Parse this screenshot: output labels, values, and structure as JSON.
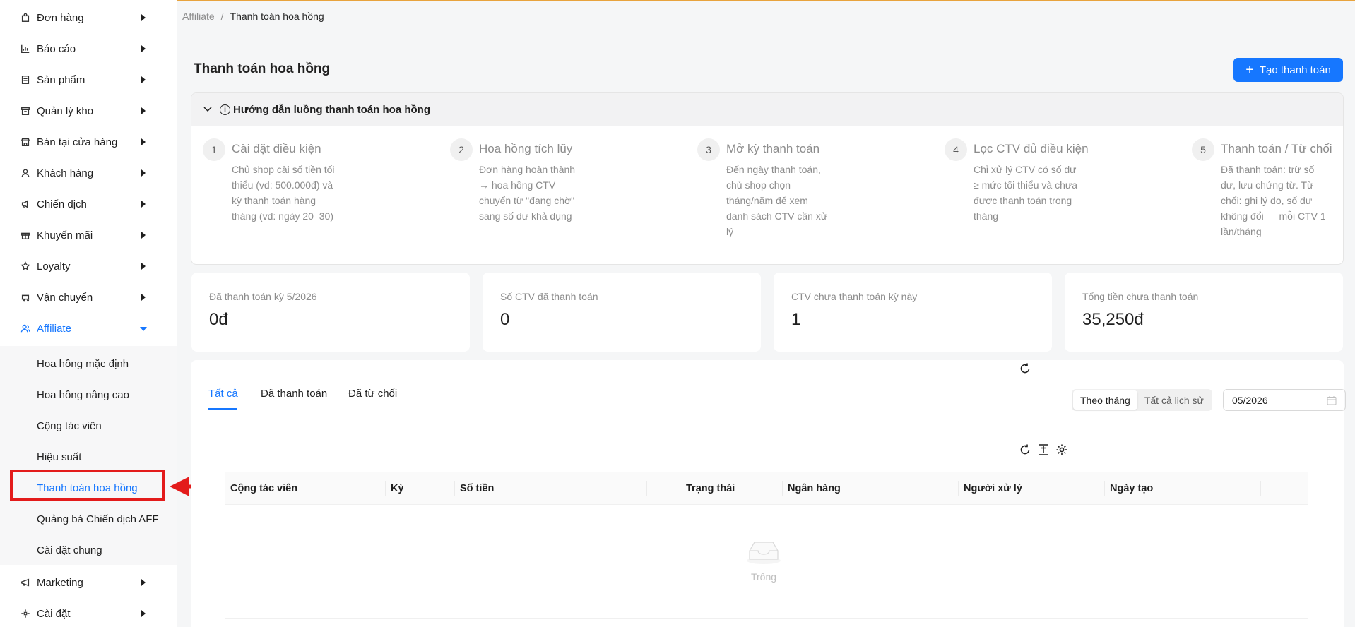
{
  "sidebar": {
    "items": [
      {
        "label": "Đơn hàng",
        "icon": "shopping-bag-icon"
      },
      {
        "label": "Báo cáo",
        "icon": "bar-chart-icon"
      },
      {
        "label": "Sản phẩm",
        "icon": "product-icon"
      },
      {
        "label": "Quản lý kho",
        "icon": "warehouse-icon"
      },
      {
        "label": "Bán tại cửa hàng",
        "icon": "store-icon"
      },
      {
        "label": "Khách hàng",
        "icon": "user-icon"
      },
      {
        "label": "Chiến dịch",
        "icon": "megaphone-icon"
      },
      {
        "label": "Khuyến mãi",
        "icon": "gift-icon"
      },
      {
        "label": "Loyalty",
        "icon": "star-icon"
      },
      {
        "label": "Vận chuyển",
        "icon": "truck-icon"
      },
      {
        "label": "Affiliate",
        "icon": "users-icon"
      }
    ],
    "affiliate_sub": [
      {
        "label": "Hoa hồng mặc định"
      },
      {
        "label": "Hoa hồng nâng cao"
      },
      {
        "label": "Cộng tác viên"
      },
      {
        "label": "Hiệu suất"
      },
      {
        "label": "Thanh toán hoa hồng"
      },
      {
        "label": "Quảng bá Chiến dịch AFF"
      },
      {
        "label": "Cài đặt chung"
      }
    ],
    "bottom_items": [
      {
        "label": "Marketing",
        "icon": "notification-icon"
      },
      {
        "label": "Cài đặt",
        "icon": "gear-icon"
      }
    ]
  },
  "breadcrumb": {
    "parent": "Affiliate",
    "separator": "/",
    "current": "Thanh toán hoa hồng"
  },
  "page": {
    "title": "Thanh toán hoa hồng",
    "create_button": "Tạo thanh toán"
  },
  "guide": {
    "title": "Hướng dẫn luồng thanh toán hoa hồng",
    "steps": [
      {
        "num": "1",
        "title": "Cài đặt điều kiện",
        "desc": "Chủ shop cài số tiền tối thiểu (vd: 500.000đ) và kỳ thanh toán hàng tháng (vd: ngày 20–30)"
      },
      {
        "num": "2",
        "title": "Hoa hồng tích lũy",
        "desc": "Đơn hàng hoàn thành → hoa hồng CTV chuyển từ \"đang chờ\" sang số dư khả dụng"
      },
      {
        "num": "3",
        "title": "Mở kỳ thanh toán",
        "desc": "Đến ngày thanh toán, chủ shop chọn tháng/năm để xem danh sách CTV cần xử lý"
      },
      {
        "num": "4",
        "title": "Lọc CTV đủ điều kiện",
        "desc": "Chỉ xử lý CTV có số dư ≥ mức tối thiểu và chưa được thanh toán trong tháng"
      },
      {
        "num": "5",
        "title": "Thanh toán / Từ chối",
        "desc": "Đã thanh toán: trừ số dư, lưu chứng từ. Từ chối: ghi lý do, số dư không đổi — mỗi CTV 1 lần/tháng"
      }
    ]
  },
  "stats": [
    {
      "label": "Đã thanh toán kỳ 5/2026",
      "value": "0đ"
    },
    {
      "label": "Số CTV đã thanh toán",
      "value": "0"
    },
    {
      "label": "CTV chưa thanh toán kỳ này",
      "value": "1"
    },
    {
      "label": "Tổng tiền chưa thanh toán",
      "value": "35,250đ"
    }
  ],
  "tabs": [
    {
      "label": "Tất cả"
    },
    {
      "label": "Đã thanh toán"
    },
    {
      "label": "Đã từ chối"
    }
  ],
  "filter": {
    "by_month": "Theo tháng",
    "all_history": "Tất cả lịch sử",
    "month_value": "05/2026"
  },
  "table": {
    "columns": [
      "Cộng tác viên",
      "Kỳ",
      "Số tiền",
      "Trạng thái",
      "Ngân hàng",
      "Người xử lý",
      "Ngày tạo"
    ],
    "empty_text": "Trống"
  },
  "colors": {
    "accent": "#1677ff",
    "highlight": "#e31b1b"
  }
}
